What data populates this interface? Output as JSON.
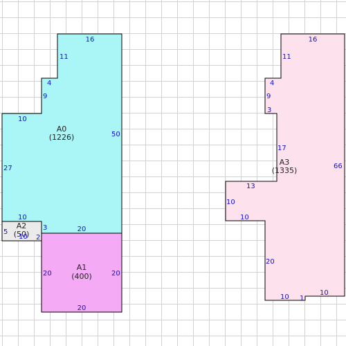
{
  "colors": {
    "grid": "#d2d2d2",
    "outline": "#000000",
    "dimension_text": "#1111cc",
    "label_text": "#222222"
  },
  "areas": [
    {
      "id": "A0",
      "name": "A0",
      "area": "(1226)",
      "fill": "#aaf5f5",
      "dimensions": [
        "16",
        "11",
        "4",
        "9",
        "10",
        "50",
        "27",
        "10",
        "3",
        "20"
      ]
    },
    {
      "id": "A1",
      "name": "A1",
      "area": "(400)",
      "fill": "#f5aaf5",
      "dimensions": [
        "20",
        "20",
        "20"
      ]
    },
    {
      "id": "A2",
      "name": "A2",
      "area": "(50)",
      "fill": "#ebebeb",
      "dimensions": [
        "5",
        "10",
        "2"
      ]
    },
    {
      "id": "A3",
      "name": "A3",
      "area": "(1335)",
      "fill": "#fde1ec",
      "dimensions": [
        "16",
        "11",
        "4",
        "9",
        "3",
        "17",
        "66",
        "13",
        "10",
        "10",
        "20",
        "10",
        "1",
        "10"
      ]
    }
  ]
}
